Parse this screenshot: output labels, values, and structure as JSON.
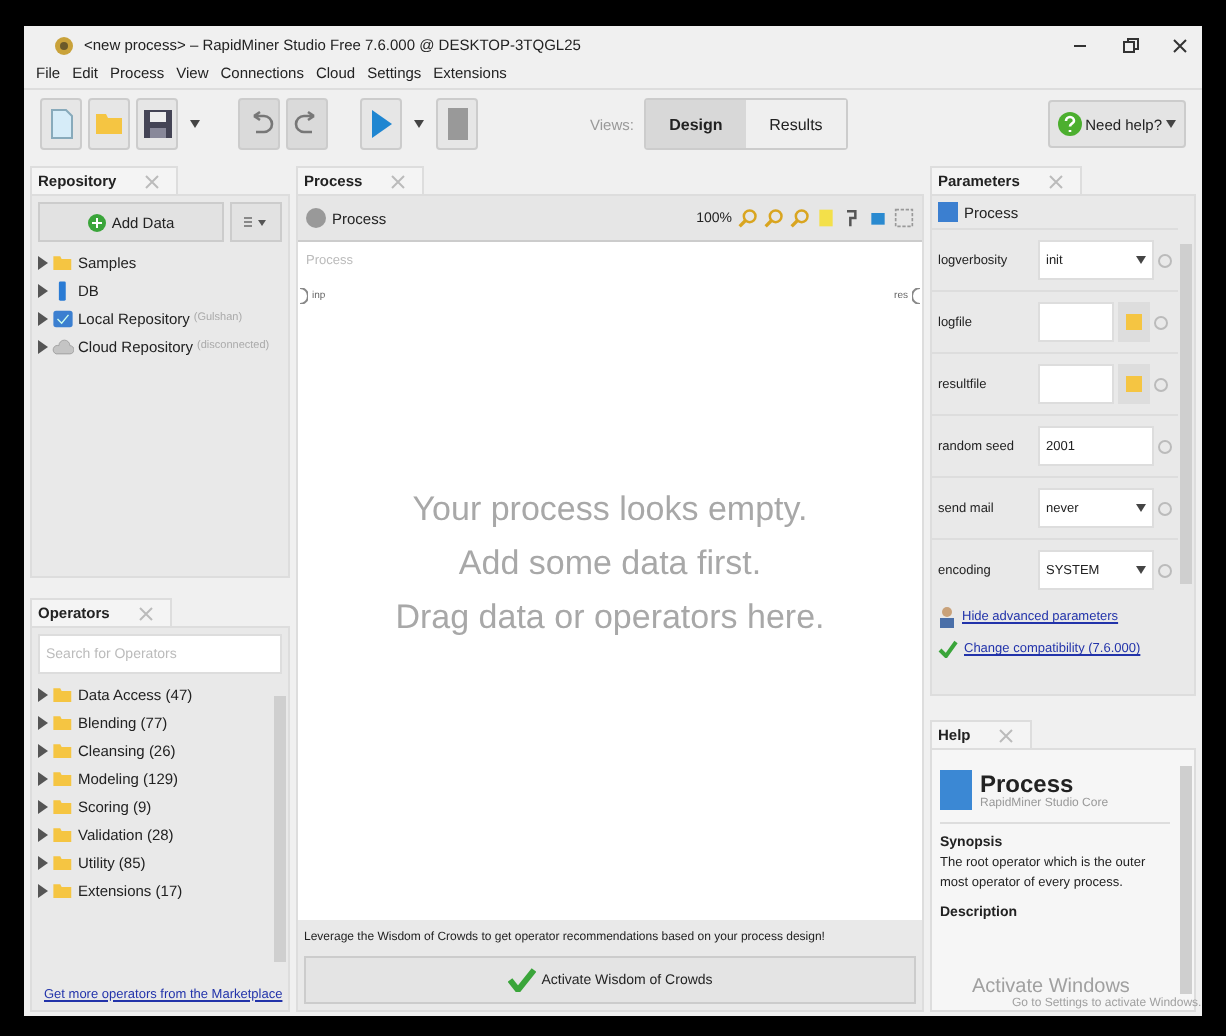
{
  "window": {
    "title": "<new process> – RapidMiner Studio Free 7.6.000 @ DESKTOP-3TQGL25"
  },
  "menu": [
    "File",
    "Edit",
    "Process",
    "View",
    "Connections",
    "Cloud",
    "Settings",
    "Extensions"
  ],
  "toolbar": {
    "views_label": "Views:",
    "views": [
      {
        "label": "Design",
        "selected": true
      },
      {
        "label": "Results",
        "selected": false
      }
    ],
    "help_button": "Need help?"
  },
  "repository": {
    "tab": "Repository",
    "add_button": "Add Data",
    "items": [
      {
        "kind": "folder",
        "label": "Samples"
      },
      {
        "kind": "db",
        "label": "DB"
      },
      {
        "kind": "local",
        "label": "Local Repository",
        "note": "(Gulshan)"
      },
      {
        "kind": "cloud",
        "label": "Cloud Repository",
        "note": "(disconnected)"
      }
    ]
  },
  "operators": {
    "tab": "Operators",
    "search": {
      "placeholder": "Search for Operators"
    },
    "items": [
      "Data Access (47)",
      "Blending (77)",
      "Cleansing (26)",
      "Modeling (129)",
      "Scoring (9)",
      "Validation (28)",
      "Utility (85)",
      "Extensions (17)"
    ],
    "marketplace_link": "Get more operators from the Marketplace"
  },
  "process": {
    "tab": "Process",
    "breadcrumb": "Process",
    "zoom": "100%",
    "canvas_label": "Process",
    "input_port": "inp",
    "result_port": "res",
    "empty_message": [
      "Your process looks empty.",
      "Add some data first.",
      "Drag data or operators here."
    ],
    "wisdom_text": "Leverage the Wisdom of Crowds to get operator recommendations based on your process design!",
    "wisdom_button": "Activate Wisdom of Crowds"
  },
  "parameters": {
    "tab": "Parameters",
    "operator": "Process",
    "rows": [
      {
        "label": "logverbosity",
        "kind": "select",
        "value": "init"
      },
      {
        "label": "logfile",
        "kind": "file",
        "value": ""
      },
      {
        "label": "resultfile",
        "kind": "file",
        "value": ""
      },
      {
        "label": "random seed",
        "kind": "text",
        "value": "2001"
      },
      {
        "label": "send mail",
        "kind": "select",
        "value": "never"
      },
      {
        "label": "encoding",
        "kind": "select",
        "value": "SYSTEM"
      }
    ],
    "advanced_link": "Hide advanced parameters",
    "compat_link": "Change compatibility (7.6.000)"
  },
  "help": {
    "tab": "Help",
    "title": "Process",
    "subtitle": "RapidMiner Studio Core",
    "synopsis_heading": "Synopsis",
    "synopsis": "The root operator which is the outer most operator of every process.",
    "description_heading": "Description",
    "notice": [
      "Activate Windows",
      "Go to Settings to activate Windows."
    ]
  }
}
